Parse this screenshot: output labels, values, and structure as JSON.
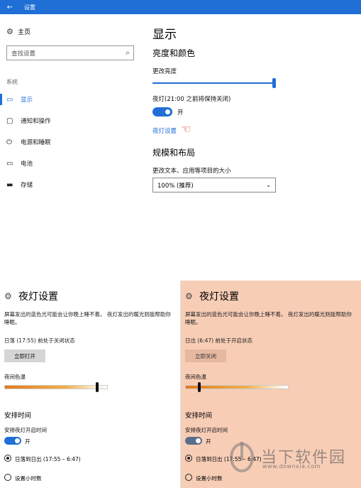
{
  "window": {
    "back_glyph": "←",
    "title": "设置"
  },
  "sidebar": {
    "home": "主页",
    "search_placeholder": "查找设置",
    "section": "系统",
    "items": [
      {
        "label": "显示",
        "icon": "monitor-icon"
      },
      {
        "label": "通知和操作",
        "icon": "notification-icon"
      },
      {
        "label": "电源和睡眠",
        "icon": "power-icon"
      },
      {
        "label": "电池",
        "icon": "battery-icon"
      },
      {
        "label": "存储",
        "icon": "storage-icon"
      }
    ]
  },
  "main": {
    "title": "显示",
    "brightness_heading": "亮度和颜色",
    "brightness_label": "更改亮度",
    "brightness_level": 1.0,
    "night_light_label": "夜灯(21:00 之前将保持关闭)",
    "night_light_state": "开",
    "night_light_settings_link": "夜灯设置",
    "scale_heading": "规模和布局",
    "scale_label": "更改文本、应用等项目的大小",
    "scale_value": "100% (推荐)"
  },
  "panels": [
    {
      "title": "夜灯设置",
      "description": "屏幕发出的蓝色光可能会让你晚上睡不着。 夜灯发出的暖光则能帮助你睡眠。",
      "status": "日落 (17:55) 前处于关闭状态",
      "button": "立即打开",
      "temperature_label": "夜间色温",
      "temperature_level": 0.89,
      "schedule_heading": "安排时间",
      "schedule_label": "安排夜灯开启时间",
      "schedule_toggle": "开",
      "option1": "日落到日出 (17:55 – 6:47)",
      "option2": "设置小时数"
    },
    {
      "title": "夜灯设置",
      "description": "屏幕发出的蓝色光可能会让你晚上睡不着。 夜灯发出的暖光则能帮助你睡眠。",
      "status": "日出 (6:47) 前处于开启状态",
      "button": "立即关闭",
      "temperature_label": "夜间色温",
      "temperature_level": 0.13,
      "schedule_heading": "安排时间",
      "schedule_label": "安排夜灯开启时间",
      "schedule_toggle": "开",
      "option1": "日落到日出 (17:55 – 6:47)",
      "option2": "设置小时数"
    }
  ],
  "watermark": {
    "brand": "当下软件园",
    "url": "www.downxia.com"
  },
  "colors": {
    "accent": "#1f6fd6",
    "night_panel_bg": "#f8cdb6"
  }
}
